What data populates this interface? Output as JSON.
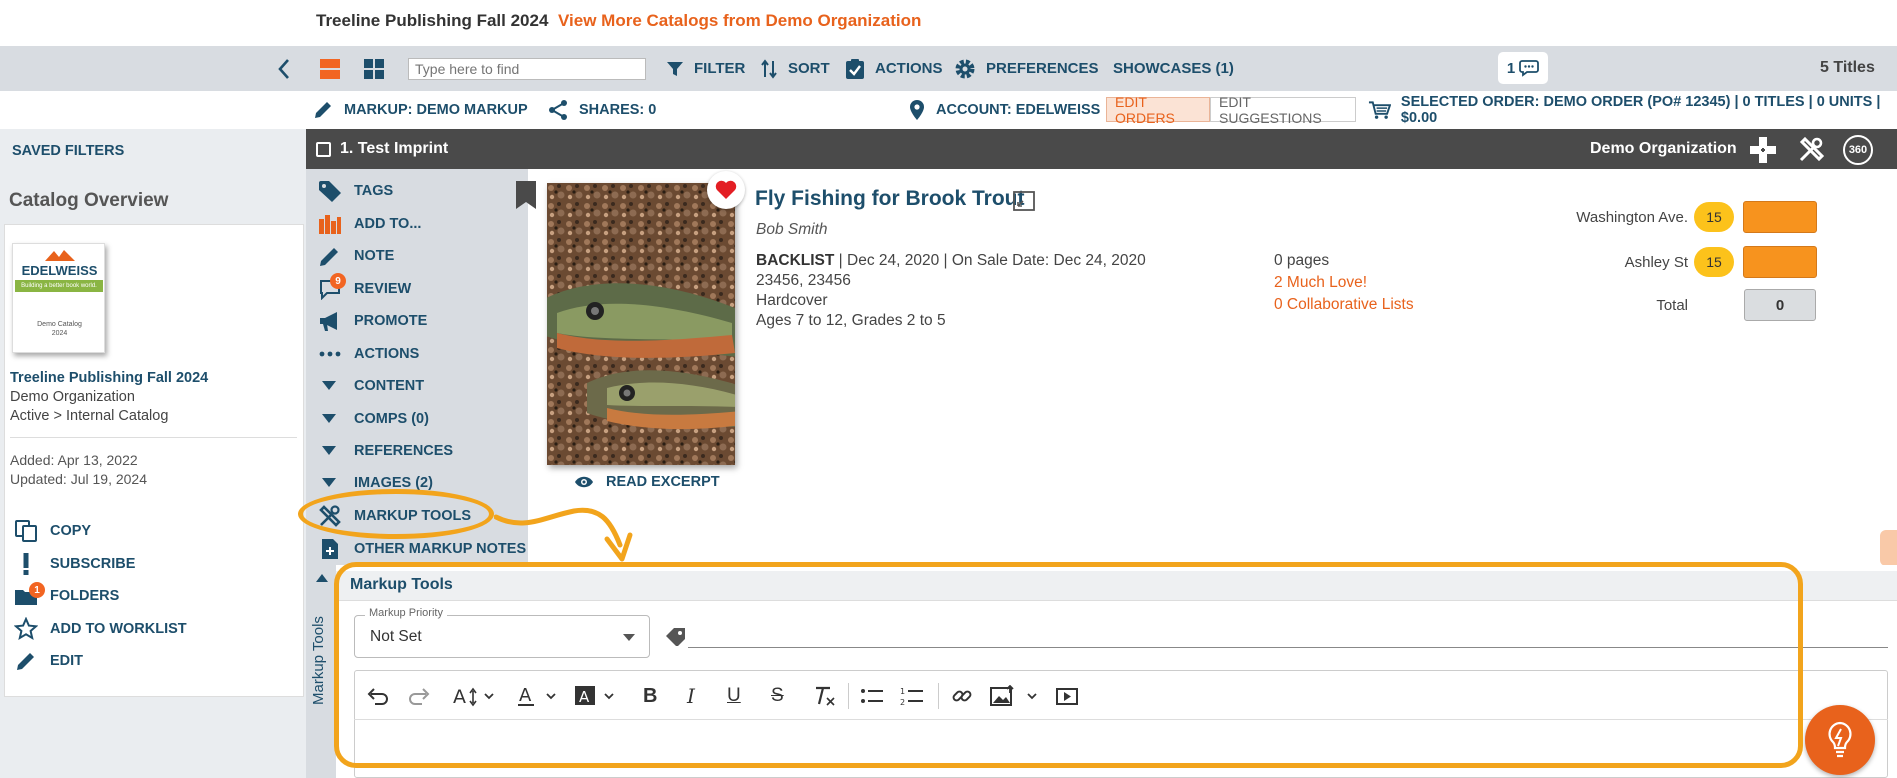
{
  "header": {
    "catalog_title": "Treeline Publishing Fall 2024",
    "view_more_link": "View More Catalogs from Demo Organization"
  },
  "toolbar": {
    "search_placeholder": "Type here to find",
    "filter": "FILTER",
    "sort": "SORT",
    "actions": "ACTIONS",
    "preferences": "PREFERENCES",
    "showcases": "SHOWCASES (1)",
    "messages_count": "1",
    "titles_count": "5 Titles",
    "markup": "MARKUP: DEMO MARKUP",
    "shares": "SHARES: 0",
    "account": "ACCOUNT: EDELWEISS",
    "edit_orders": "EDIT ORDERS",
    "edit_suggestions": "EDIT SUGGESTIONS",
    "selected_order": "SELECTED ORDER: DEMO ORDER (PO# 12345) | 0 TITLES | 0 UNITS | $0.00"
  },
  "sidebar": {
    "saved_filters": "SAVED FILTERS",
    "overview_title": "Catalog Overview",
    "cover_brand": "EDELWEISS",
    "cover_tagline": "Building a better book world.",
    "cover_caption_1": "Demo Catalog",
    "cover_caption_2": "2024",
    "catalog_name": "Treeline Publishing Fall 2024",
    "organization": "Demo Organization",
    "status": "Active > Internal Catalog",
    "added": "Added: Apr 13, 2022",
    "updated": "Updated: Jul 19, 2024",
    "actions": {
      "copy": "COPY",
      "subscribe": "SUBSCRIBE",
      "folders": "FOLDERS",
      "folders_badge": "1",
      "add_to_worklist": "ADD TO WORKLIST",
      "edit": "EDIT"
    }
  },
  "imprint_bar": {
    "label": "1. Test Imprint",
    "organization": "Demo Organization"
  },
  "title_actions": {
    "tags": "TAGS",
    "add_to": "ADD TO...",
    "note": "NOTE",
    "review": "REVIEW",
    "review_badge": "9",
    "promote": "PROMOTE",
    "actions": "ACTIONS",
    "content": "CONTENT",
    "comps": "COMPS (0)",
    "references": "REFERENCES",
    "images": "IMAGES (2)",
    "markup_tools": "MARKUP TOOLS",
    "other_markup_notes": "OTHER MARKUP NOTES"
  },
  "product": {
    "title": "Fly Fishing for Brook Trout",
    "author": "Bob Smith",
    "status": "BACKLIST",
    "dates": "| Dec 24, 2020 | On Sale Date: Dec 24, 2020",
    "isbns": "23456, 23456",
    "format": "Hardcover",
    "ages": "Ages 7 to 12, Grades 2 to 5",
    "pages": "0 pages",
    "love": "2 Much Love!",
    "collab_lists": "0 Collaborative Lists",
    "read_excerpt": "READ EXCERPT"
  },
  "orders": {
    "stores": [
      {
        "name": "Washington Ave.",
        "qty": "15"
      },
      {
        "name": "Ashley St",
        "qty": "15"
      }
    ],
    "total_label": "Total",
    "total_value": "0"
  },
  "markup_tools": {
    "side_label": "Markup Tools",
    "title": "Markup Tools",
    "priority_label": "Markup Priority",
    "priority_value": "Not Set"
  },
  "colors": {
    "brand_blue": "#1d4e6b",
    "accent_orange": "#e8621c",
    "highlight": "#f2a41c",
    "toolbar_gray": "#d8dce1",
    "dark_bar": "#4a4a4a"
  }
}
